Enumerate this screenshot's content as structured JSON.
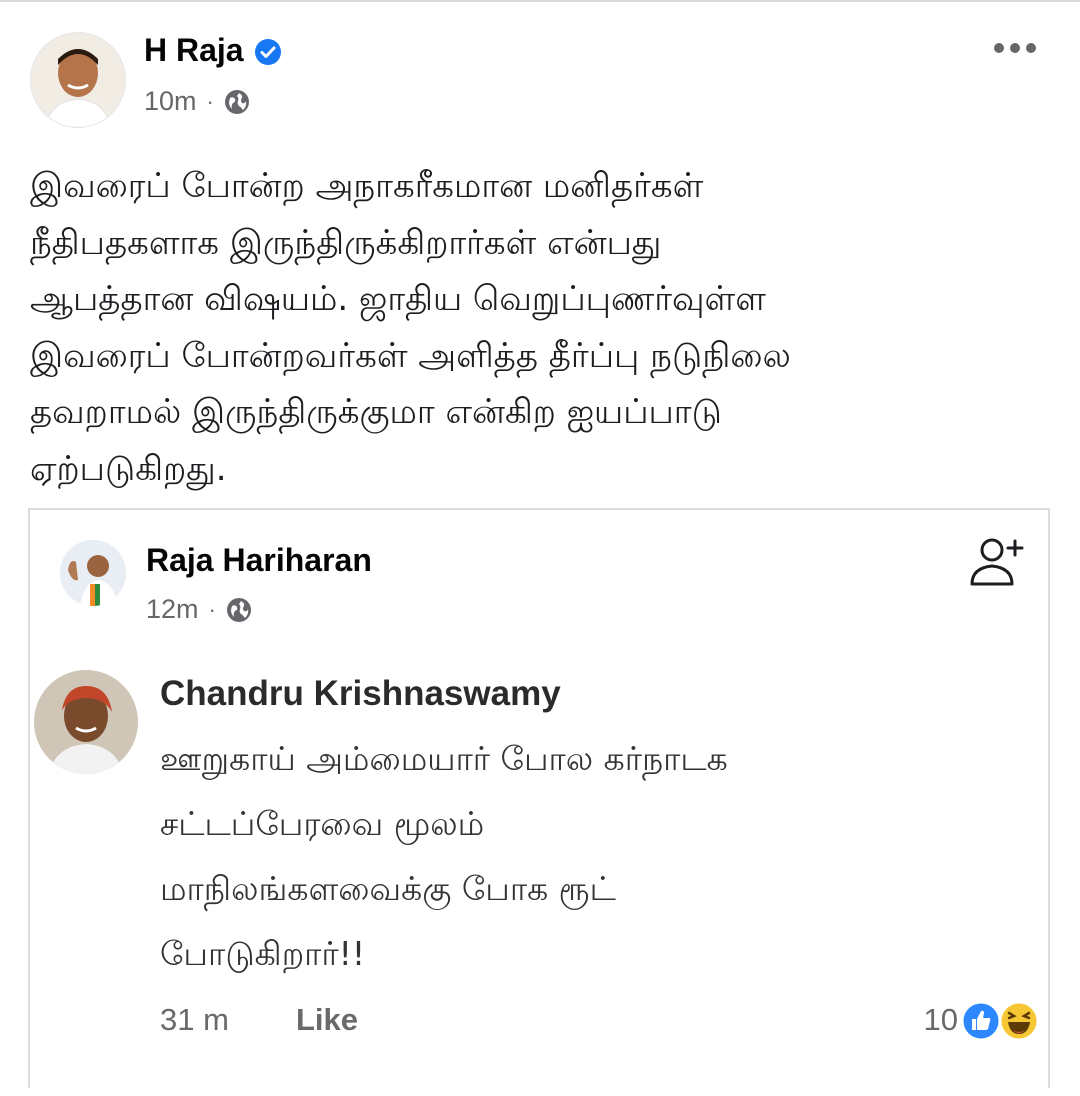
{
  "post": {
    "author": "H Raja",
    "time": "10m",
    "separator": "·",
    "text": "இவரைப் போன்ற அநாகரீகமான மனிதர்கள்\nநீதிபதகளாக இருந்திருக்கிறார்கள் என்பது\nஆபத்தான விஷயம். ஜாதிய வெறுப்புணர்வுள்ள\nஇவரைப் போன்றவர்கள் அளித்த தீர்ப்பு நடுநிலை\nதவறாமல் இருந்திருக்குமா என்கிற ஐயப்பாடு\nஏற்படுகிறது."
  },
  "shared": {
    "author": "Raja Hariharan",
    "time": "12m",
    "separator": "·"
  },
  "comment": {
    "author": "Chandru Krishnaswamy",
    "text": "ஊறுகாய் அம்மையார் போல கர்நாடக\nசட்டப்பேரவை மூலம்\nமாநிலங்களவைக்கு போக ரூட்\nபோடுகிறார்!!",
    "time": "31 m",
    "like_label": "Like",
    "reaction_count": "10"
  },
  "icons": {
    "verified": "verified-badge-icon",
    "globe": "globe-icon",
    "more": "more-horizontal-icon",
    "add_friend": "add-friend-icon",
    "like_reaction": "like-reaction-icon",
    "haha_reaction": "haha-reaction-icon"
  },
  "colors": {
    "facebook_blue": "#1877f2",
    "meta_gray": "#65676b",
    "card_border": "#dadde1"
  }
}
